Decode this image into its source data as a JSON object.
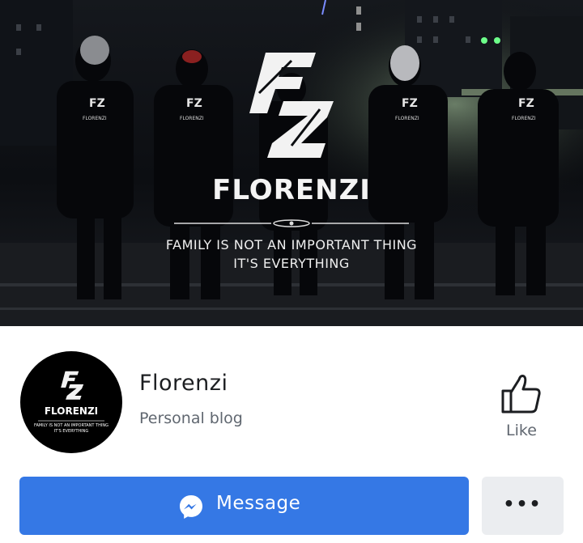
{
  "cover": {
    "brand": "FLORENZI",
    "tagline_line1": "FAMILY IS NOT AN IMPORTANT THING",
    "tagline_line2": "IT'S EVERYTHING",
    "logo_text": "FZ",
    "jacket_text": "FLORENZI"
  },
  "avatar": {
    "brand": "FLORENZI",
    "tagline_line1": "FAMILY IS NOT AN IMPORTANT THING",
    "tagline_line2": "IT'S EVERYTHING"
  },
  "page": {
    "name": "Florenzi",
    "category": "Personal blog"
  },
  "actions": {
    "like_label": "Like",
    "message_label": "Message",
    "more_label": "•••"
  },
  "icons": {
    "like": "thumbs-up-icon",
    "message": "messenger-icon",
    "more": "more-dots-icon"
  },
  "colors": {
    "message_button": "#3578e5",
    "more_button": "#ebedf0",
    "cover_background": "#0b0d10"
  }
}
